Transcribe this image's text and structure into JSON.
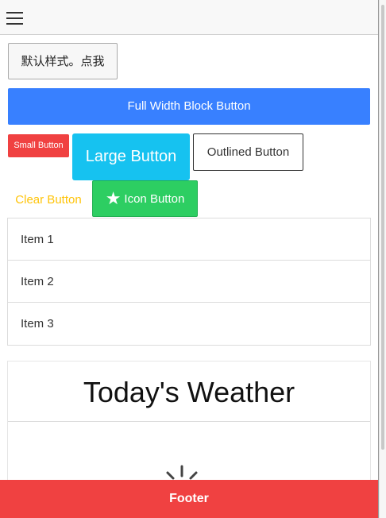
{
  "toolbar": {
    "menu_icon": "hamburger-menu-icon"
  },
  "buttons": {
    "default": "默认样式。点我",
    "full_width_block": "Full Width Block Button",
    "small": "Small Button",
    "large": "Large Button",
    "outlined": "Outlined Button",
    "clear": "Clear Button",
    "icon": "Icon Button",
    "icon_glyph": "star-icon"
  },
  "list": {
    "items": [
      {
        "label": "Item 1"
      },
      {
        "label": "Item 2"
      },
      {
        "label": "Item 3"
      }
    ]
  },
  "card": {
    "title": "Today's Weather",
    "loading_icon": "spinner-icon"
  },
  "footer": {
    "label": "Footer"
  },
  "colors": {
    "primary": "#3880ff",
    "danger": "#f04141",
    "secondary": "#16c2f0",
    "warning": "#ffc409",
    "success": "#2dce62"
  }
}
